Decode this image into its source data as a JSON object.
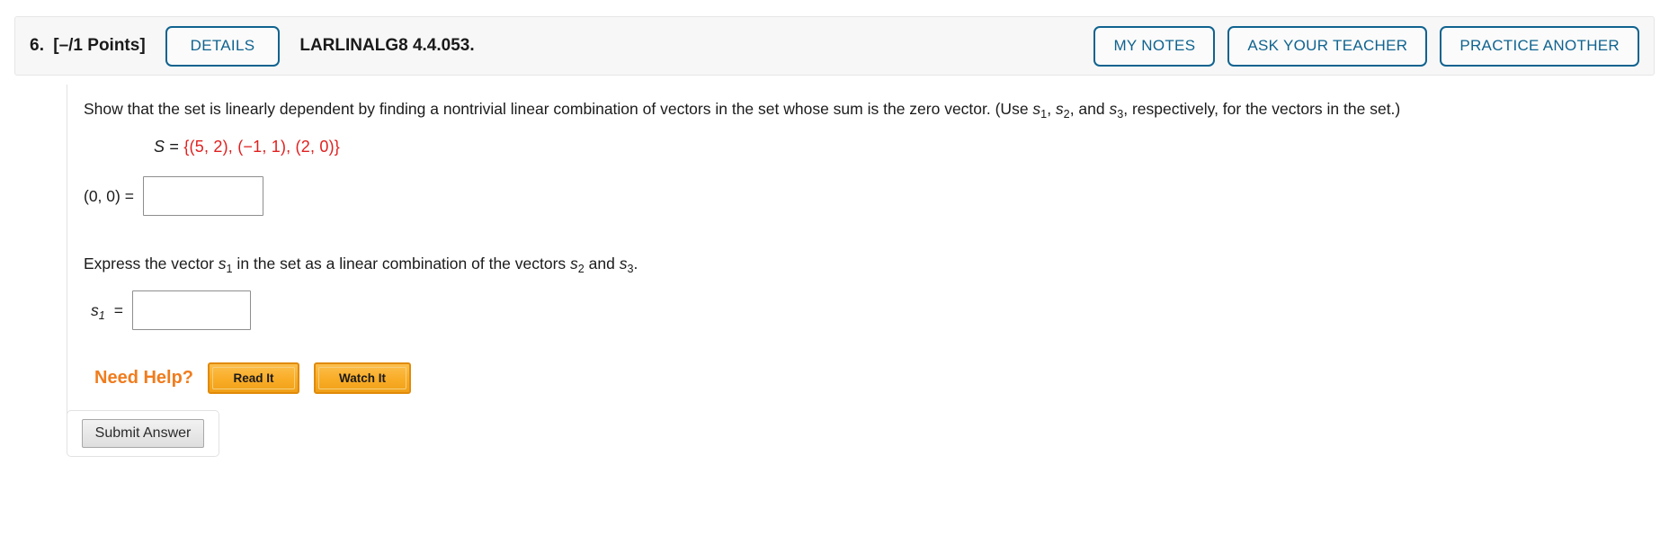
{
  "header": {
    "question_number": "6.",
    "points": "[–/1 Points]",
    "details_label": "DETAILS",
    "question_code": "LARLINALG8 4.4.053.",
    "my_notes_label": "MY NOTES",
    "ask_teacher_label": "ASK YOUR TEACHER",
    "practice_another_label": "PRACTICE ANOTHER",
    "accent_color": "#10638f"
  },
  "prompt": {
    "part1": "Show that the set is linearly dependent by finding a nontrivial linear combination of vectors in the set whose sum is the zero vector. (Use ",
    "s1": "s",
    "s1_sub": "1",
    "sep1": ", ",
    "s2": "s",
    "s2_sub": "2",
    "sep2": ", and ",
    "s3": "s",
    "s3_sub": "3",
    "part2": ",  respectively, for the vectors in the set.)"
  },
  "set_definition": {
    "name": "S",
    "equals": "=",
    "open": "{(",
    "v1x": "5",
    "v1_sep": ", ",
    "v1y": "2",
    "mid1": "), (",
    "v2x": "−1",
    "v2_sep": ", ",
    "v2y": "1",
    "mid2": "), (",
    "v3x": "2",
    "v3_sep": ", ",
    "v3y": "0",
    "close": ")}",
    "number_color": "#e02020"
  },
  "answer_zero": {
    "label": "(0, 0) =",
    "value": "",
    "placeholder": ""
  },
  "express": {
    "part1": "Express the vector ",
    "s1": "s",
    "s1_sub": "1",
    "part2": " in the set as a linear combination of the vectors ",
    "s2": "s",
    "s2_sub": "2",
    "part3": " and ",
    "s3": "s",
    "s3_sub": "3",
    "part4": "."
  },
  "answer_s1": {
    "label_var": "s",
    "label_sub": "1",
    "label_eq": "=",
    "value": "",
    "placeholder": ""
  },
  "need_help": {
    "label": "Need Help?",
    "read_it_label": "Read It",
    "watch_it_label": "Watch It",
    "label_color": "#f07c1e"
  },
  "submit": {
    "label": "Submit Answer"
  }
}
